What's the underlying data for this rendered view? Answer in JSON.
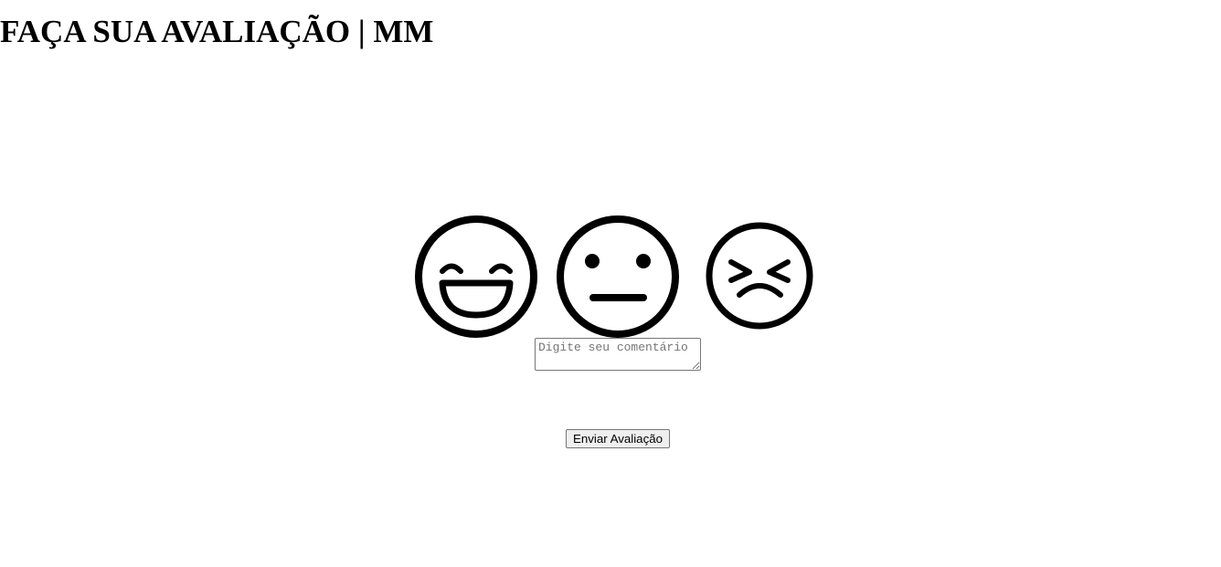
{
  "page": {
    "title": "FAÇA SUA AVALIAÇÃO | MM"
  },
  "ratings": [
    {
      "icon": "grinning-face-icon"
    },
    {
      "icon": "neutral-face-icon"
    },
    {
      "icon": "persevering-face-icon"
    }
  ],
  "comment": {
    "value": "",
    "placeholder": "Digite seu comentário"
  },
  "submit": {
    "label": "Enviar Avaliação"
  },
  "colors": {
    "icon_stroke": "#000000",
    "background": "#ffffff",
    "button_background": "#efefef"
  }
}
